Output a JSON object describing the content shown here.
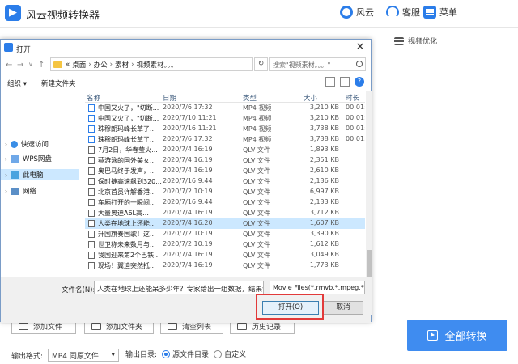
{
  "app": {
    "title": "风云视频转换器",
    "brand_label": "风云",
    "service_label": "客服",
    "menu_label": "菜单",
    "tool_optimize_label": "视频优化",
    "bottom_buttons": [
      "添加文件",
      "添加文件夹",
      "清空列表",
      "历史记录"
    ],
    "convert_all_label": "全部转换",
    "output_format_label": "输出格式:",
    "output_format_value": "MP4 同原文件",
    "output_dir_label": "输出目录:",
    "output_dir_option_source": "源文件目录",
    "output_dir_option_custom": "自定义",
    "accent_color": "#3f8cf0"
  },
  "dialog": {
    "title": "打开",
    "address_crumbs": [
      "«",
      "桌面",
      "办公",
      "素材",
      "视频素材。。。"
    ],
    "search_placeholder": "搜索\"视频素材。。。\"",
    "organize_label": "组织 ▾",
    "new_folder_label": "新建文件夹",
    "nav": [
      {
        "label": "快速访问",
        "icon": "star-icon",
        "selected": false
      },
      {
        "label": "WPS网盘",
        "icon": "cloud-icon",
        "selected": false
      },
      {
        "label": "此电脑",
        "icon": "computer-icon",
        "selected": true
      },
      {
        "label": "网络",
        "icon": "network-icon",
        "selected": false
      }
    ],
    "columns": [
      "名称",
      "日期",
      "类型",
      "大小",
      "时长"
    ],
    "files": [
      {
        "name": "中国又火了，\"切断...",
        "date": "2020/7/6 17:32",
        "type": "MP4 视频",
        "size": "3,210 KB",
        "extra": "00:01:0",
        "kind": "mp4"
      },
      {
        "name": "中国又火了，\"切断...",
        "date": "2020/7/10 11:21",
        "type": "MP4 视频",
        "size": "3,210 KB",
        "extra": "00:01:0",
        "kind": "mp4"
      },
      {
        "name": "珠穆朗玛峰长草了...",
        "date": "2020/7/16 11:21",
        "type": "MP4 视频",
        "size": "3,738 KB",
        "extra": "00:01:1",
        "kind": "mp4"
      },
      {
        "name": "珠穆朗玛峰长草了...",
        "date": "2020/7/6 17:32",
        "type": "MP4 视频",
        "size": "3,738 KB",
        "extra": "00:01:1",
        "kind": "mp4"
      },
      {
        "name": "7月2日，华春莹火...",
        "date": "2020/7/4 16:19",
        "type": "QLV 文件",
        "size": "1,893 KB",
        "extra": "",
        "kind": "qlv"
      },
      {
        "name": "蔡游泳的国外美女...",
        "date": "2020/7/4 16:19",
        "type": "QLV 文件",
        "size": "2,351 KB",
        "extra": "",
        "kind": "qlv"
      },
      {
        "name": "奥巴马终于发声，...",
        "date": "2020/7/4 16:19",
        "type": "QLV 文件",
        "size": "2,610 KB",
        "extra": "",
        "kind": "qlv"
      },
      {
        "name": "保时捷高速飙到320...",
        "date": "2020/7/16 9:44",
        "type": "QLV 文件",
        "size": "2,136 KB",
        "extra": "",
        "kind": "qlv"
      },
      {
        "name": "北京首员详解香港...",
        "date": "2020/7/2 10:19",
        "type": "QLV 文件",
        "size": "6,997 KB",
        "extra": "",
        "kind": "qlv"
      },
      {
        "name": "车厢打开的一瞬间...",
        "date": "2020/7/16 9:44",
        "type": "QLV 文件",
        "size": "2,133 KB",
        "extra": "",
        "kind": "qlv"
      },
      {
        "name": "大量奥迪A6L高…",
        "date": "2020/7/4 16:19",
        "type": "QLV 文件",
        "size": "3,712 KB",
        "extra": "",
        "kind": "qlv"
      },
      {
        "name": "人类在地球上还能...",
        "date": "2020/7/4 16:20",
        "type": "QLV 文件",
        "size": "1,607 KB",
        "extra": "",
        "kind": "qlv",
        "selected": true
      },
      {
        "name": "升国旗奏国歌！这...",
        "date": "2020/7/2 10:19",
        "type": "QLV 文件",
        "size": "3,390 KB",
        "extra": "",
        "kind": "qlv"
      },
      {
        "name": "世卫称未来数月与...",
        "date": "2020/7/2 10:19",
        "type": "QLV 文件",
        "size": "1,612 KB",
        "extra": "",
        "kind": "qlv"
      },
      {
        "name": "我国迎来第2个巴铁...",
        "date": "2020/7/4 16:19",
        "type": "QLV 文件",
        "size": "3,049 KB",
        "extra": "",
        "kind": "qlv"
      },
      {
        "name": "现场！翼迪突然抵...",
        "date": "2020/7/4 16:19",
        "type": "QLV 文件",
        "size": "1,773 KB",
        "extra": "",
        "kind": "qlv"
      }
    ],
    "filename_label": "文件名(N):",
    "filename_value": "人类在地球上还能呆多少年？专家给出一组数据，结果让人",
    "filetype_value": "Movie Files(*.rmvb,*.mpeg,*.e",
    "open_label": "打开(O)",
    "cancel_label": "取消",
    "highlight_color": "#e23a3a"
  }
}
